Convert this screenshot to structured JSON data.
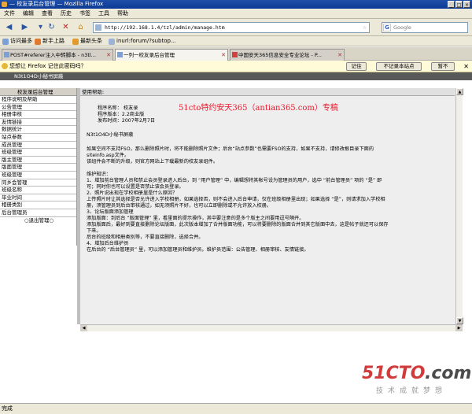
{
  "window": {
    "title": "— 校友录后台管理 — Mozilla Firefox"
  },
  "menu": [
    "文件",
    "编辑",
    "查看",
    "历史",
    "书签",
    "工具",
    "帮助"
  ],
  "nav": {
    "url": "http://192.168.1.4/tzl/admin/manage.htm",
    "search_placeholder": "Google"
  },
  "bookmarks": [
    "访问最多",
    "新手上路",
    "最新头条",
    "inurl:forum/?subtop..."
  ],
  "tabs": [
    {
      "label": "POST#referer注入中转脚本 - n3tl..."
    },
    {
      "label": "一列一校友录后台管理"
    },
    {
      "label": "中国安天365信息安全专业论坛 - P..."
    }
  ],
  "notification": {
    "text": "您想让 Firefox 记住此密码吗？",
    "remember": "记住",
    "never": "不记录本站点",
    "not_now": "暂不"
  },
  "banner": "N3t1O4D小秘书屏蔽",
  "sidebar": {
    "header": "校友录后台管理",
    "items": [
      "程序说明及帮助",
      "公告管理",
      "相册审核",
      "友情链接",
      "数据统计",
      "站点参数",
      "成员管理",
      "班级管理",
      "版主管理",
      "版面管理",
      "班级管理",
      "同乡会管理",
      "班级名称",
      "毕业时间",
      "相册类别",
      "后台管理员"
    ],
    "logout": "○退出管理○"
  },
  "help": {
    "header": "使用帮助:",
    "prog_name": "程序名称：          校友录",
    "prog_version": "程序版本：2.2商业版",
    "release_date": "发布时间：2007年2月7日",
    "overlay": "51cto特约安天365（antian365.com）专稿",
    "sig": "N3t1O4D小秘书屏蔽",
    "lines": [
      "如果空间不支持FSO，那么删除照片时，将不能删除照片文件；后台“站点参数”也需要FSO的支持，如果不支持，请修改根目录下面的",
      "siteinfo.asp文件。",
      "该组件会不断的升级，则官方网站上下载最新的校友录组件。",
      "",
      "维护知识：",
      "1、增加前台管理人员和禁止会员登录进入后台，到 “用户管理” 中，编辑想将其帐号设为管理员的用户，选中 “前台管理员” 项的 “是” 即",
      "可；同时你也可以设置是否禁止该会员登录。",
      "2、照片说出现在学校相册里是什么原因？",
      "上传照片时让其选择是否允许进入学校相册，如果选择否，则不会进入后台申请，仅在班级相册里出现；如果选择 “是”，则请求加入学校相",
      "册，须管理员到后台审核通过，如无须照片不好，也可以立即删除或不允许放入校册。",
      "3、论坛版面添加管理",
      "添加版面：到后台 “版面管理” 里，看里面的提示操作，其中要注意的是多个版主之间要用逗号隔开。",
      "添加版面后，最好到要直接删除论坛版面，此次版本增加了合并版面功能，可以将要删除的版面合并到其它版面中去，这是帖子就还可以保存",
      "下来。",
      "后台的班级和相册类别等，不要直接删除，选择合并。",
      "4、增加后台维护员",
      "在后台的 “后台管理员” 里，可以添加管理员和维护员。维护员范围：公告管理、相册审核、友情链接。"
    ]
  },
  "watermark": {
    "brand": "51CTO",
    "domain": ".com",
    "slogan": "技术成就梦想"
  },
  "status": "完成"
}
